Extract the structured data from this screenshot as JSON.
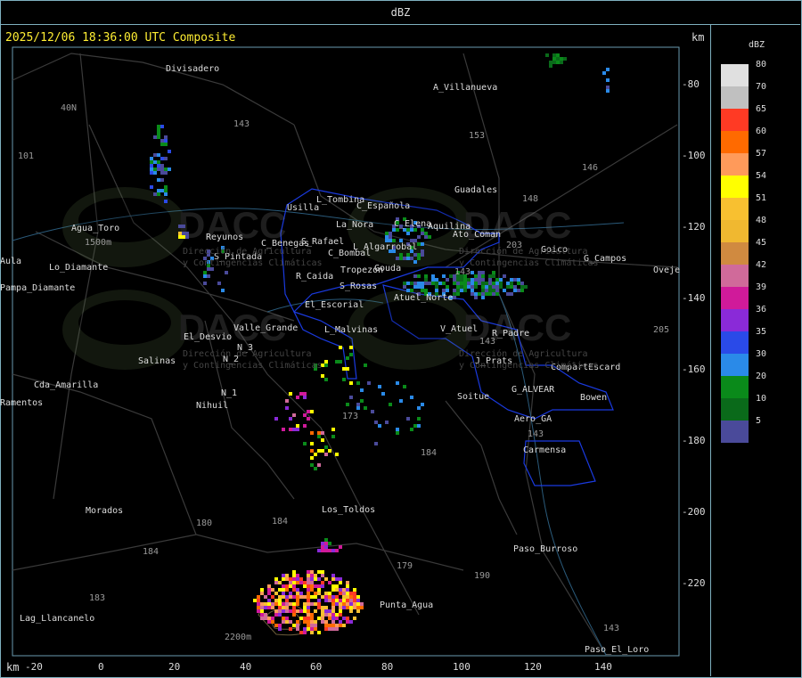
{
  "title": "dBZ",
  "header": "2025/12/06 18:36:00 UTC Composite",
  "units": {
    "top_right": "km",
    "bottom_left": "km"
  },
  "x_ticks": [
    "-20",
    "0",
    "20",
    "40",
    "60",
    "80",
    "100",
    "120",
    "140"
  ],
  "y_ticks": [
    "-80",
    "-100",
    "-120",
    "-140",
    "-160",
    "-180",
    "-200",
    "-220"
  ],
  "legend": {
    "title": "dBZ",
    "levels": [
      {
        "label": "80",
        "color": "#e0e0e0"
      },
      {
        "label": "70",
        "color": "#c0c0c0"
      },
      {
        "label": "65",
        "color": "#ff3a24"
      },
      {
        "label": "60",
        "color": "#ff6a00"
      },
      {
        "label": "57",
        "color": "#ff9a5a"
      },
      {
        "label": "54",
        "color": "#ffff00"
      },
      {
        "label": "51",
        "color": "#f8c030"
      },
      {
        "label": "48",
        "color": "#f0b830"
      },
      {
        "label": "45",
        "color": "#d08a40"
      },
      {
        "label": "42",
        "color": "#d06a9a"
      },
      {
        "label": "39",
        "color": "#d01a9a"
      },
      {
        "label": "36",
        "color": "#8a2ad8"
      },
      {
        "label": "35",
        "color": "#2a4ae8"
      },
      {
        "label": "30",
        "color": "#2a8ae8"
      },
      {
        "label": "20",
        "color": "#0a8a1a"
      },
      {
        "label": "10",
        "color": "#0a6a1a"
      },
      {
        "label": "5",
        "color": "#4a4a9a"
      }
    ]
  },
  "watermark": {
    "logo_text": "DACC",
    "line1": "Dirección de Agricultura",
    "line2": "y Contingencias Climáticas"
  },
  "places": [
    "Divisadero",
    "A_Villanueva",
    "Guadales",
    "Agua_Toro",
    "Usilla",
    "C_Española",
    "C_Elena",
    "Aquilina",
    "Ato_Coman",
    "Goico",
    "G_Campos",
    "Reyunos",
    "Pampa_Diamante",
    "S_Pintada",
    "S_Rafael",
    "C_Benegas",
    "C_Bombal",
    "L_Algarrobal",
    "La_Nora",
    "L_Tombina",
    "R_Caida",
    "S_Rosas",
    "Tropezon",
    "Gouda",
    "Atuel_Norte",
    "El_Escorial",
    "Valle_Grande",
    "L_Malvinas",
    "V_Atuel",
    "R_Padre",
    "El_Desvio",
    "Salinas",
    "N_2",
    "N_3",
    "N_1",
    "Nihuil",
    "Cda_Amarilla",
    "Ramentos",
    "J_Prats",
    "CompartEscard",
    "G_ALVEAR",
    "Soitue",
    "Bowen",
    "Aero_GA",
    "Carmensa",
    "Los_Toldos",
    "Morados",
    "Paso_Burroso",
    "Punta_Agua",
    "Lag_Llancanelo",
    "Paso_El_Loro",
    "Oveje",
    "Aula",
    "Lo_Diamante"
  ],
  "roads": [
    "143",
    "153",
    "146",
    "148",
    "203",
    "205",
    "101",
    "40N",
    "143",
    "173",
    "184",
    "179",
    "180",
    "184",
    "190",
    "183",
    "143",
    "184",
    "143",
    "143"
  ],
  "elev": [
    "1500m",
    "2200m"
  ]
}
